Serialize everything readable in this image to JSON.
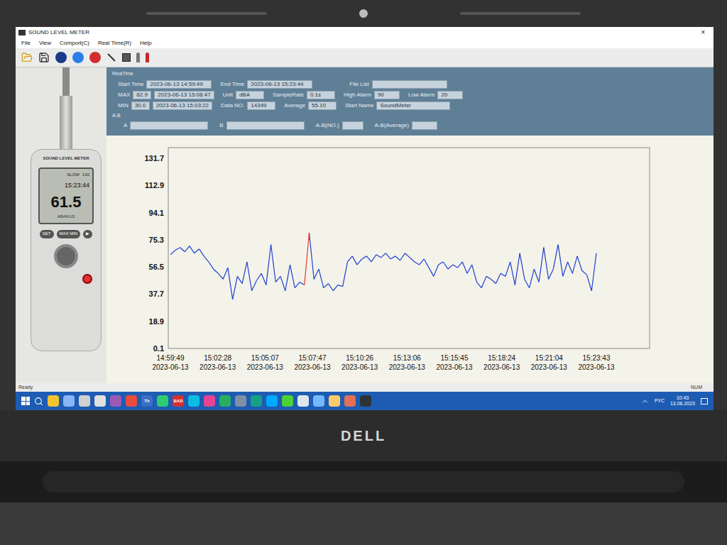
{
  "window": {
    "title": "SOUND LEVEL METER",
    "close": "×"
  },
  "menu": [
    "File",
    "View",
    "Comport(C)",
    "Real Time(R)",
    "Help"
  ],
  "device": {
    "label": "SOUND LEVEL METER",
    "mode": "SLOW",
    "range": "130",
    "time": "15:23:44",
    "reading": "61.5",
    "brand": "ABAKUS",
    "buttons": [
      "SET",
      "MAX MIN",
      "▶"
    ]
  },
  "realtime": {
    "group": "RealTime",
    "start_time": {
      "label": "Start Time",
      "value": "2023-06-13 14:59:49"
    },
    "end_time": {
      "label": "End Time",
      "value": "2023-06-13 15:23:44"
    },
    "file_list": {
      "label": "File List",
      "value": ""
    },
    "max": {
      "label": "MAX",
      "value": "82.9",
      "time": "2023-06-13 15:08:47"
    },
    "min": {
      "label": "MIN",
      "value": "30.0",
      "time": "2023-06-13 15:03:22"
    },
    "unit": {
      "label": "Unit",
      "value": "dBA"
    },
    "sample_rate": {
      "label": "SampleRate",
      "value": "0.1s"
    },
    "high_alarm": {
      "label": "High Alarm",
      "value": "90"
    },
    "low_alarm": {
      "label": "Low Alarm",
      "value": "20"
    },
    "data_no": {
      "label": "Data NO.",
      "value": "14349"
    },
    "average": {
      "label": "Average",
      "value": "55.10"
    },
    "start_name": {
      "label": "Start Name",
      "value": "SoundMeter"
    }
  },
  "ab": {
    "group": "A-B",
    "a": {
      "label": "A",
      "value": ""
    },
    "b": {
      "label": "B",
      "value": ""
    },
    "ab_no": {
      "label": "A-B(NO.)",
      "value": ""
    },
    "ab_avg": {
      "label": "A-B(Average)",
      "value": ""
    }
  },
  "chart": {
    "y_ticks": [
      "131.7",
      "112.9",
      "94.1",
      "75.3",
      "56.5",
      "37.7",
      "18.9",
      "0.1"
    ],
    "x_ticks": [
      {
        "time": "14:59:49",
        "date": "2023-06-13"
      },
      {
        "time": "15:02:28",
        "date": "2023-06-13"
      },
      {
        "time": "15:05:07",
        "date": "2023-06-13"
      },
      {
        "time": "15:07:47",
        "date": "2023-06-13"
      },
      {
        "time": "15:10:26",
        "date": "2023-06-13"
      },
      {
        "time": "15:13:06",
        "date": "2023-06-13"
      },
      {
        "time": "15:15:45",
        "date": "2023-06-13"
      },
      {
        "time": "15:18:24",
        "date": "2023-06-13"
      },
      {
        "time": "15:21:04",
        "date": "2023-06-13"
      },
      {
        "time": "15:23:43",
        "date": "2023-06-13"
      }
    ],
    "series": [
      {
        "color": "#1f3fd0",
        "values": [
          65,
          68,
          70,
          67,
          71,
          66,
          69,
          64,
          60,
          55,
          52,
          48,
          56,
          34,
          50,
          45,
          60,
          40,
          47,
          52,
          44,
          72,
          46,
          50,
          40,
          58,
          42,
          46,
          44,
          80,
          48,
          55,
          42,
          45,
          40,
          44,
          43,
          60,
          64,
          58,
          62,
          64,
          60,
          65,
          63,
          66,
          62,
          64,
          61,
          66,
          63,
          60,
          58,
          62,
          56,
          50,
          58,
          60,
          55,
          58,
          56,
          60,
          52,
          58,
          46,
          42,
          50,
          48,
          45,
          52,
          50,
          60,
          44,
          66,
          48,
          42,
          55,
          46,
          70,
          48,
          55,
          72,
          50,
          60,
          52,
          64,
          54,
          51,
          40,
          66
        ]
      }
    ],
    "max_marker": {
      "index": 29,
      "color": "#e53935"
    }
  },
  "status_bar": {
    "left": "Ready",
    "right": "NUM"
  },
  "taskbar": {
    "apps": [
      {
        "label": "",
        "color": "#f4c430"
      },
      {
        "label": "",
        "color": "#8ab4f8"
      },
      {
        "label": "",
        "color": "#d0d0d0"
      },
      {
        "label": "",
        "color": "#e0e0e0"
      },
      {
        "label": "",
        "color": "#9b59b6"
      },
      {
        "label": "",
        "color": "#e74c3c"
      },
      {
        "label": "Th",
        "color": "#3b6fc4"
      },
      {
        "label": "",
        "color": "#2ecc71"
      },
      {
        "label": "BAD",
        "color": "#d63031"
      },
      {
        "label": "",
        "color": "#0abde3"
      },
      {
        "label": "",
        "color": "#e84393"
      },
      {
        "label": "",
        "color": "#27ae60"
      },
      {
        "label": "",
        "color": "#7f8fa6"
      },
      {
        "label": "",
        "color": "#16a085"
      },
      {
        "label": "",
        "color": "#00a8ff"
      },
      {
        "label": "",
        "color": "#4cd137"
      },
      {
        "label": "",
        "color": "#dfe6e9"
      },
      {
        "label": "",
        "color": "#74b9ff"
      },
      {
        "label": "",
        "color": "#fdcb6e"
      },
      {
        "label": "",
        "color": "#e17055"
      },
      {
        "label": "",
        "color": "#2d3436"
      }
    ],
    "tray": {
      "language": "РУС",
      "time": "10:43",
      "date": "13.06.2023"
    }
  },
  "bezel": {
    "logo": "DELL"
  }
}
